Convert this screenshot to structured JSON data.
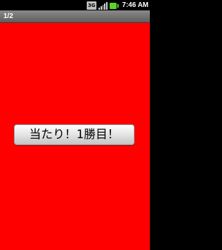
{
  "status_bar": {
    "network_label": "3G",
    "time": "7:46 AM"
  },
  "title_bar": {
    "title": "1/2"
  },
  "content": {
    "background_color": "#ff0000",
    "button_label": "当たり！1勝目！"
  }
}
